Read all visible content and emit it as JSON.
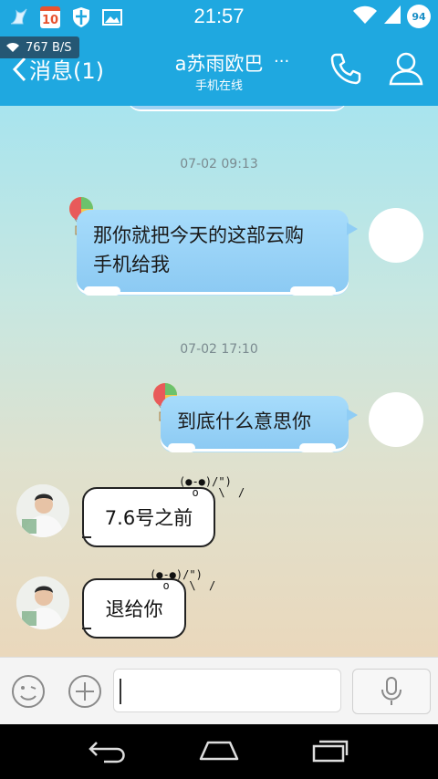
{
  "status_bar": {
    "time": "21:57",
    "calendar_day": "10",
    "battery": "94",
    "icons": [
      "bird-icon",
      "calendar-icon",
      "shield-icon",
      "image-icon",
      "wifi-icon",
      "signal-icon",
      "battery-icon"
    ]
  },
  "net_speed": "767 B/S",
  "header": {
    "back_label": "消息(1)",
    "title": "a苏雨欧巴",
    "more": "...",
    "subtitle": "手机在线"
  },
  "messages": [
    {
      "type": "timestamp",
      "text": "07-02 09:13"
    },
    {
      "type": "outgoing",
      "lines": [
        "那你就把今天的这部云购",
        "手机给我"
      ]
    },
    {
      "type": "timestamp",
      "text": "07-02 17:10"
    },
    {
      "type": "outgoing",
      "lines": [
        "到底什么意思你"
      ]
    },
    {
      "type": "incoming",
      "text": "7.6号之前",
      "kaomoji": "(●-●)/\")\n  o   \\  /"
    },
    {
      "type": "incoming",
      "text": "退给你",
      "kaomoji": "(●-●)/\")\n  o   \\  /"
    }
  ],
  "input": {
    "value": ""
  },
  "colors": {
    "accent": "#1fa8e0",
    "bubble_out": "#9ed3f3"
  }
}
